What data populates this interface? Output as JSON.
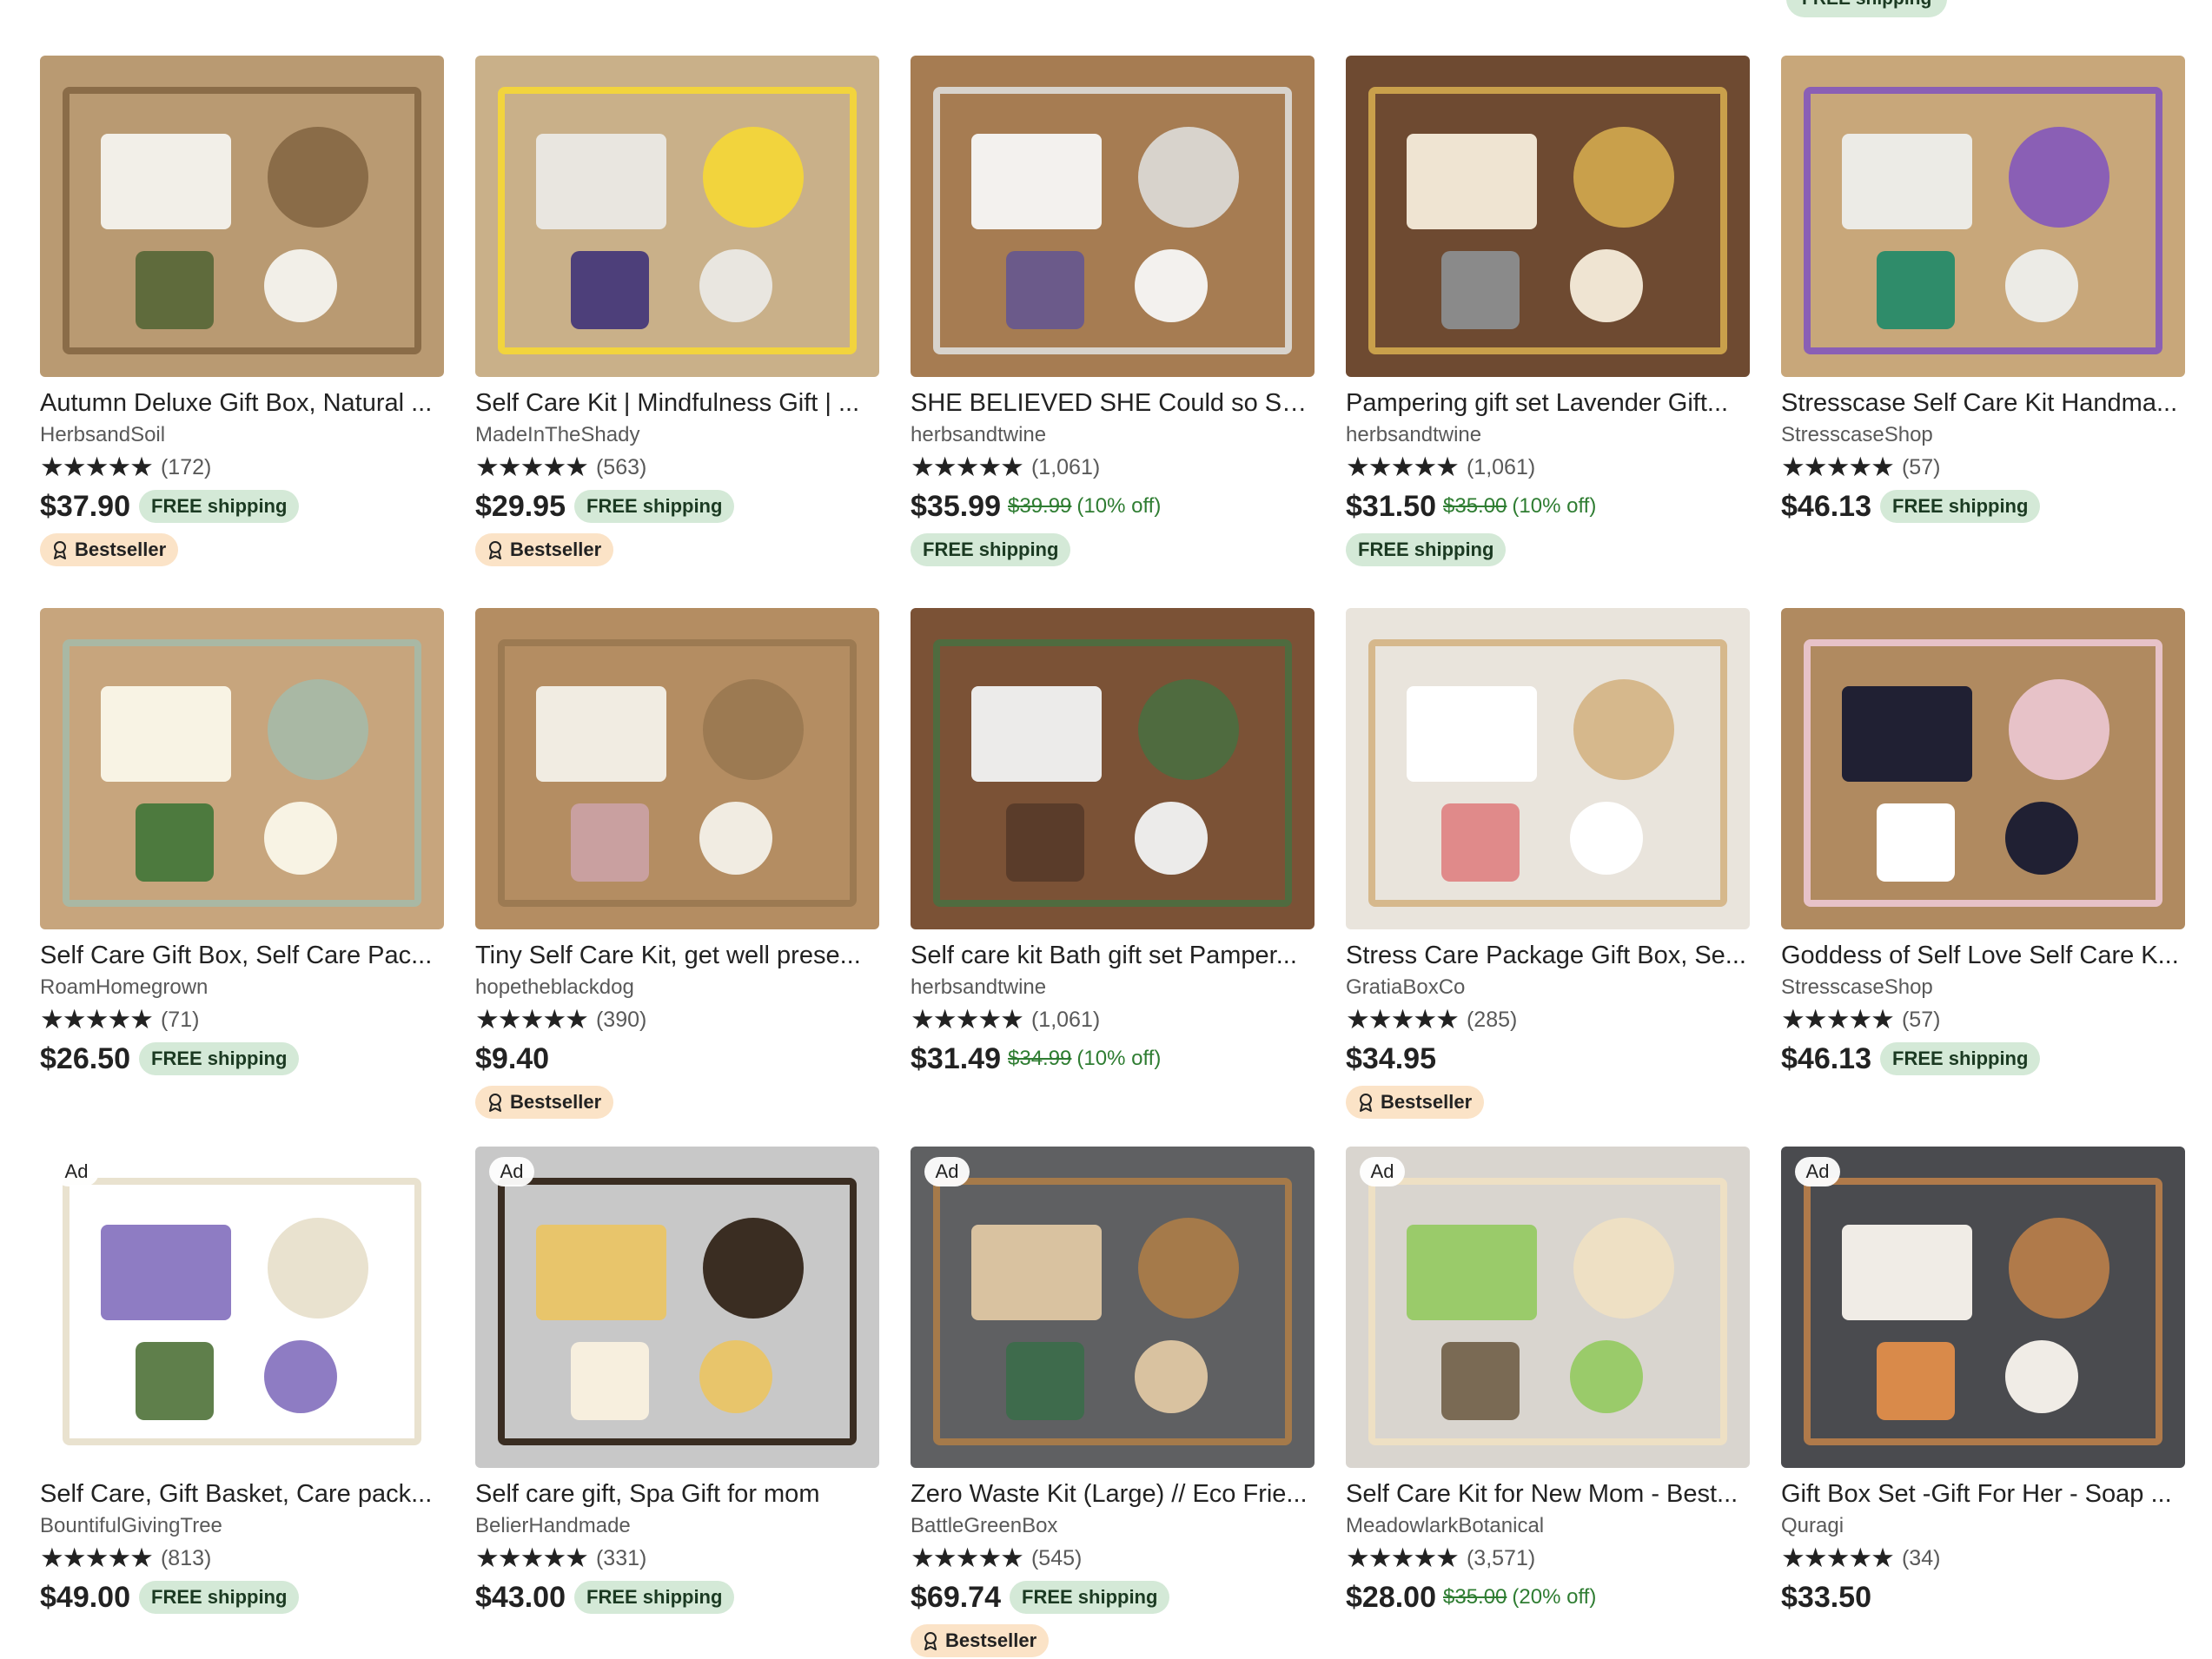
{
  "top_badge": "FREE shipping",
  "listings": [
    {
      "title": "Autumn Deluxe Gift Box, Natural ...",
      "shop": "HerbsandSoil",
      "stars": "★★★★★",
      "reviews": "(172)",
      "price": "$37.90",
      "original": "",
      "discount": "",
      "free_inline": "FREE shipping",
      "free_below": "",
      "bestseller": "Bestseller",
      "ad": "",
      "thumb": {
        "bg": "#b99a72",
        "a": "#f2efe8",
        "b": "#8a6c48",
        "c": "#5f6b3c"
      }
    },
    {
      "title": "Self Care Kit | Mindfulness Gift | ...",
      "shop": "MadeInTheShady",
      "stars": "★★★★★",
      "reviews": "(563)",
      "price": "$29.95",
      "original": "",
      "discount": "",
      "free_inline": "FREE shipping",
      "free_below": "",
      "bestseller": "Bestseller",
      "ad": "",
      "thumb": {
        "bg": "#c9b089",
        "a": "#e9e6e0",
        "b": "#f2d43d",
        "c": "#4d3f7a"
      }
    },
    {
      "title": "SHE BELIEVED SHE Could so She...",
      "shop": "herbsandtwine",
      "stars": "★★★★★",
      "reviews": "(1,061)",
      "price": "$35.99",
      "original": "$39.99",
      "discount": "(10% off)",
      "free_inline": "",
      "free_below": "FREE shipping",
      "bestseller": "",
      "ad": "",
      "thumb": {
        "bg": "#a67c52",
        "a": "#f3f1ee",
        "b": "#d8d3cc",
        "c": "#6b5a8a"
      }
    },
    {
      "title": "Pampering gift set Lavender Gift...",
      "shop": "herbsandtwine",
      "stars": "★★★★★",
      "reviews": "(1,061)",
      "price": "$31.50",
      "original": "$35.00",
      "discount": "(10% off)",
      "free_inline": "",
      "free_below": "FREE shipping",
      "bestseller": "",
      "ad": "",
      "thumb": {
        "bg": "#6e4a31",
        "a": "#efe4d2",
        "b": "#c9a04b",
        "c": "#8a8a8a"
      }
    },
    {
      "title": "Stresscase Self Care Kit Handma...",
      "shop": "StresscaseShop",
      "stars": "★★★★★",
      "reviews": "(57)",
      "price": "$46.13",
      "original": "",
      "discount": "",
      "free_inline": "FREE shipping",
      "free_below": "",
      "bestseller": "",
      "ad": "",
      "thumb": {
        "bg": "#c8a77a",
        "a": "#ecebe6",
        "b": "#8a5fb5",
        "c": "#2f8c6a"
      }
    },
    {
      "title": "Self Care Gift Box, Self Care Pac...",
      "shop": "RoamHomegrown",
      "stars": "★★★★★",
      "reviews": "(71)",
      "price": "$26.50",
      "original": "",
      "discount": "",
      "free_inline": "FREE shipping",
      "free_below": "",
      "bestseller": "",
      "ad": "",
      "thumb": {
        "bg": "#c7a57d",
        "a": "#f8f3e4",
        "b": "#a9b8a4",
        "c": "#4d7a3e"
      }
    },
    {
      "title": "Tiny Self Care Kit, get well prese...",
      "shop": "hopetheblackdog",
      "stars": "★★★★★",
      "reviews": "(390)",
      "price": "$9.40",
      "original": "",
      "discount": "",
      "free_inline": "",
      "free_below": "",
      "bestseller": "Bestseller",
      "ad": "",
      "thumb": {
        "bg": "#b48d62",
        "a": "#f1ece2",
        "b": "#9c7a52",
        "c": "#c9a0a0"
      }
    },
    {
      "title": "Self care kit Bath gift set Pamper...",
      "shop": "herbsandtwine",
      "stars": "★★★★★",
      "reviews": "(1,061)",
      "price": "$31.49",
      "original": "$34.99",
      "discount": "(10% off)",
      "free_inline": "",
      "free_below": "",
      "bestseller": "",
      "ad": "",
      "thumb": {
        "bg": "#7b5236",
        "a": "#ecebea",
        "b": "#4f6b3f",
        "c": "#5a3c2a"
      }
    },
    {
      "title": "Stress Care Package Gift Box, Se...",
      "shop": "GratiaBoxCo",
      "stars": "★★★★★",
      "reviews": "(285)",
      "price": "$34.95",
      "original": "",
      "discount": "",
      "free_inline": "",
      "free_below": "",
      "bestseller": "Bestseller",
      "ad": "",
      "thumb": {
        "bg": "#e9e4dc",
        "a": "#ffffff",
        "b": "#d6b88c",
        "c": "#e08a8a"
      }
    },
    {
      "title": "Goddess of Self Love Self Care K...",
      "shop": "StresscaseShop",
      "stars": "★★★★★",
      "reviews": "(57)",
      "price": "$46.13",
      "original": "",
      "discount": "",
      "free_inline": "FREE shipping",
      "free_below": "",
      "bestseller": "",
      "ad": "",
      "thumb": {
        "bg": "#b08a60",
        "a": "#202033",
        "b": "#e7c2c8",
        "c": "#ffffff"
      }
    },
    {
      "title": "Self Care, Gift Basket, Care pack...",
      "shop": "BountifulGivingTree",
      "stars": "★★★★★",
      "reviews": "(813)",
      "price": "$49.00",
      "original": "",
      "discount": "",
      "free_inline": "FREE shipping",
      "free_below": "",
      "bestseller": "",
      "ad": "Ad",
      "thumb": {
        "bg": "#ffffff",
        "a": "#8e7cc3",
        "b": "#e9e2cf",
        "c": "#5f7f4b"
      }
    },
    {
      "title": "Self care gift, Spa Gift for mom",
      "shop": "BelierHandmade",
      "stars": "★★★★★",
      "reviews": "(331)",
      "price": "$43.00",
      "original": "",
      "discount": "",
      "free_inline": "FREE shipping",
      "free_below": "",
      "bestseller": "",
      "ad": "Ad",
      "thumb": {
        "bg": "#c8c8c8",
        "a": "#e8c56b",
        "b": "#3a2d22",
        "c": "#f7efde"
      }
    },
    {
      "title": "Zero Waste Kit (Large) // Eco Frie...",
      "shop": "BattleGreenBox",
      "stars": "★★★★★",
      "reviews": "(545)",
      "price": "$69.74",
      "original": "",
      "discount": "",
      "free_inline": "FREE shipping",
      "free_below": "",
      "bestseller": "Bestseller",
      "ad": "Ad",
      "thumb": {
        "bg": "#5f6062",
        "a": "#d9c2a0",
        "b": "#a57a4a",
        "c": "#3e6b4c"
      }
    },
    {
      "title": "Self Care Kit for New Mom - Best...",
      "shop": "MeadowlarkBotanical",
      "stars": "★★★★★",
      "reviews": "(3,571)",
      "price": "$28.00",
      "original": "$35.00",
      "discount": "(20% off)",
      "free_inline": "",
      "free_below": "",
      "bestseller": "",
      "ad": "Ad",
      "thumb": {
        "bg": "#d9d5cf",
        "a": "#9acb6a",
        "b": "#eee0c4",
        "c": "#7a6a54"
      }
    },
    {
      "title": "Gift Box Set -Gift For Her - Soap ...",
      "shop": "Quragi",
      "stars": "★★★★★",
      "reviews": "(34)",
      "price": "$33.50",
      "original": "",
      "discount": "",
      "free_inline": "",
      "free_below": "",
      "bestseller": "",
      "ad": "Ad",
      "thumb": {
        "bg": "#4a4b4f",
        "a": "#f0ece6",
        "b": "#b07a4a",
        "c": "#d98a4a"
      }
    }
  ]
}
